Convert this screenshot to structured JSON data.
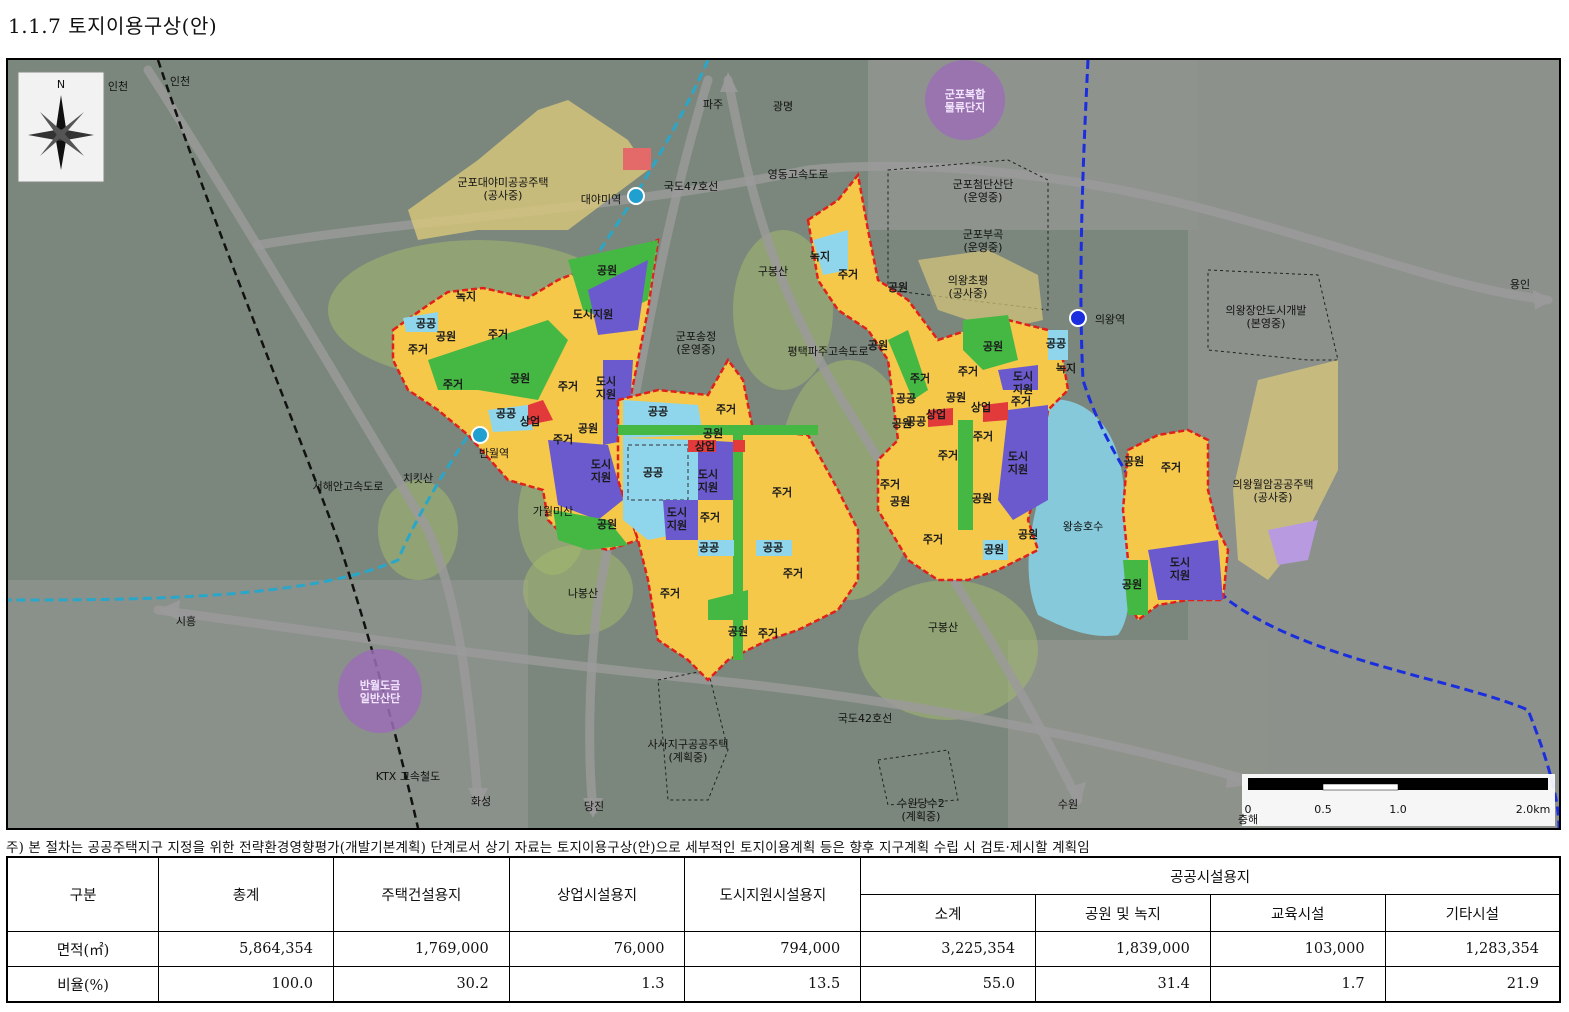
{
  "document": {
    "title": "1.1.7 토지이용구상(안)",
    "note": "주) 본 절차는 공공주택지구 지정을 위한 전략환경영향평가(개발기본계획) 단계로서 상기 자료는 토지이용구상(안)으로 세부적인 토지이용계획 등은 향후 지구계획 수립 시 검토·제시할 계획임"
  },
  "map": {
    "compass_label": "N",
    "scale": {
      "ticks": [
        "0",
        "0.5",
        "1.0",
        "2.0km"
      ],
      "side_label": "충해"
    },
    "colors": {
      "residential": "#f6c84a",
      "park": "#45b844",
      "public": "#8fd6ec",
      "city_support": "#6a5acd",
      "commercial": "#e23a3a",
      "boundary": "#e0201c",
      "rail_cyan": "#2aa6c8",
      "rail_blue": "#1a2ee0",
      "purple_bubble": "#9b6fb5"
    },
    "directions": [
      "인천",
      "인천",
      "파주",
      "광명",
      "용인",
      "시흥",
      "화성",
      "당진",
      "수원"
    ],
    "roads": [
      "영동고속도로",
      "국도47호선",
      "평택파주고속도로",
      "서해안고속도로",
      "국도42호선",
      "KTX 고속철도"
    ],
    "stations": [
      "대야미역",
      "반월역",
      "의왕역"
    ],
    "mountains": [
      "구봉산",
      "치킷산",
      "가월미산",
      "나봉산",
      "구봉산",
      "군포송정\n(운영중)"
    ],
    "lake": "왕송호수",
    "bubbles": [
      "군포복합\n물류단지",
      "반월도금\n일반산단"
    ],
    "nearby": [
      "군포대야미공공주택\n(공사중)",
      "군포첨단산단\n(운영중)",
      "군포부곡\n(운영중)",
      "의왕초평\n(공사중)",
      "의왕장안도시개발\n(본영중)",
      "의왕월암공공주택\n(공사중)",
      "사사지구공공주택\n(계획중)",
      "수원당수2\n(계획중)"
    ],
    "zone_labels": {
      "residential": "주거",
      "park": "공원",
      "public": "공공",
      "city_support": "도시\n지원",
      "commercial": "상업",
      "green": "녹지",
      "city_support_single": "도시지원"
    }
  },
  "table": {
    "header_row1": [
      "구분",
      "총계",
      "주택건설용지",
      "상업시설용지",
      "도시지원시설용지",
      "공공시설용지"
    ],
    "header_row2": [
      "소계",
      "공원 및 녹지",
      "교육시설",
      "기타시설"
    ],
    "rows": [
      {
        "label": "면적(㎡)",
        "values": [
          "5,864,354",
          "1,769,000",
          "76,000",
          "794,000",
          "3,225,354",
          "1,839,000",
          "103,000",
          "1,283,354"
        ]
      },
      {
        "label": "비율(%)",
        "values": [
          "100.0",
          "30.2",
          "1.3",
          "13.5",
          "55.0",
          "31.4",
          "1.7",
          "21.9"
        ]
      }
    ]
  }
}
